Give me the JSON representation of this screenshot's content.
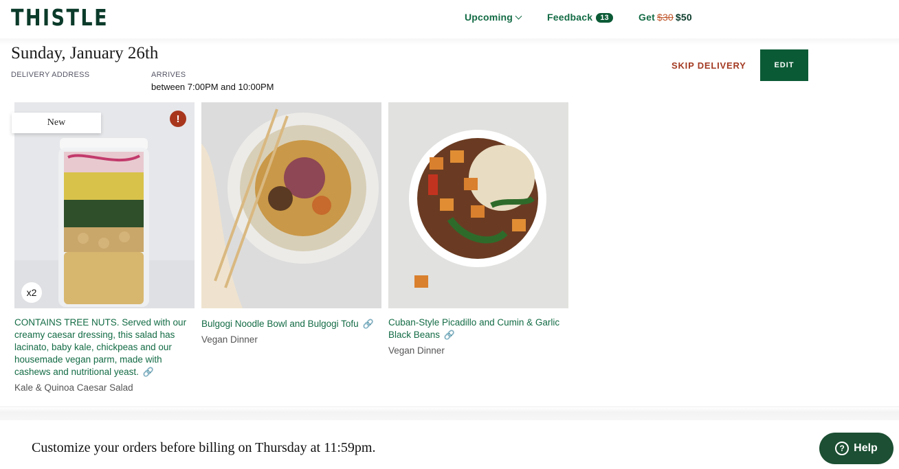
{
  "header": {
    "logo": "THISTLE",
    "nav_upcoming": "Upcoming",
    "nav_feedback": "Feedback",
    "feedback_count": "13",
    "nav_get_prefix": "Get",
    "nav_get_old": "$30",
    "nav_get_new": "$50"
  },
  "delivery": {
    "date": "Sunday, January 26th",
    "address_label": "DELIVERY ADDRESS",
    "arrives_label": "ARRIVES",
    "arrives_value": "between 7:00PM and 10:00PM",
    "skip_label": "SKIP DELIVERY",
    "edit_label": "EDIT"
  },
  "meals": [
    {
      "tag": "New",
      "alert": "!",
      "quantity": "x2",
      "title": "CONTAINS TREE NUTS. Served with our creamy caesar dressing, this salad has lacinato, baby kale, chickpeas and our housemade vegan parm, made with cashews and nutritional yeast.",
      "subtitle": "Kale & Quinoa Caesar Salad"
    },
    {
      "title": "Bulgogi Noodle Bowl and Bulgogi Tofu",
      "subtitle": "Vegan Dinner"
    },
    {
      "title": "Cuban-Style Picadillo and Cumin & Garlic Black Beans",
      "subtitle": "Vegan Dinner"
    }
  ],
  "icons": {
    "link": "link-icon",
    "alert": "alert-icon",
    "help": "question-circle-icon",
    "chevron": "chevron-down-icon"
  },
  "colors": {
    "brand_green": "#0b5a36",
    "link_green": "#136b45",
    "skip_red": "#a33a22",
    "alert_red": "#a8361d"
  },
  "footer": {
    "billing_text": "Customize your orders before billing on Thursday at 11:59pm.",
    "help_label": "Help"
  }
}
